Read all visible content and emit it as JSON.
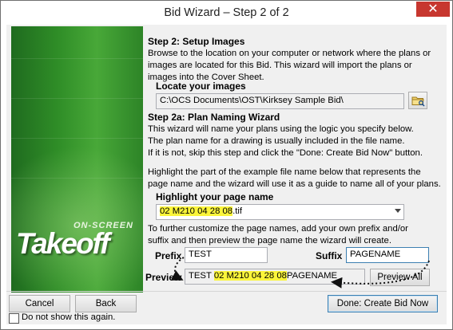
{
  "window": {
    "title": "Bid Wizard – Step 2 of 2",
    "close_glyph": "✕"
  },
  "brand": {
    "tagline": "ON-SCREEN",
    "name": "Takeoff"
  },
  "step2": {
    "heading": "Step 2: Setup Images",
    "desc": [
      "Browse to the location on your computer or network where the plans or",
      "images are located for this Bid. This wizard will import the plans or",
      "images into the Cover Sheet."
    ]
  },
  "locate": {
    "label": "Locate your images",
    "path": "C:\\OCS Documents\\OST\\Kirksey Sample Bid\\",
    "browse_icon": "folder-browse-icon"
  },
  "step2a": {
    "heading": "Step 2a: Plan Naming Wizard",
    "desc": [
      "This wizard will name your plans using the logic you specify below.",
      "The plan name for a drawing is usually included in the file name.",
      "If it is not, skip this step and click the \"Done: Create Bid Now\" button."
    ],
    "desc2": [
      "Highlight the part of the example file name below that represents the",
      "page name and the wizard will use it as a guide to name all of your plans."
    ]
  },
  "highlight": {
    "label": "Highlight your page name",
    "file_highlighted": "02 M210 04 28 08",
    "file_rest": ".tif"
  },
  "customize": [
    "To further customize the page names, add your own prefix and/or",
    "suffix and then preview the page name the wizard will create."
  ],
  "prefix": {
    "label": "Prefix",
    "value": "TEST"
  },
  "suffix": {
    "label": "Suffix",
    "value": "PAGENAME"
  },
  "preview": {
    "label": "Preview",
    "value_prefix": "TEST ",
    "value_highlighted": "02 M210 04 28 08",
    "value_suffix": "PAGENAME",
    "button": "Preview All"
  },
  "footer": {
    "cancel": "Cancel",
    "back": "Back",
    "done": "Done: Create Bid Now",
    "checkbox_label": "Do not show this again.",
    "checkbox_checked": false
  },
  "colors": {
    "highlight": "#fbf53a",
    "brand_green": "#2f8d27",
    "close_red": "#c7372f"
  }
}
